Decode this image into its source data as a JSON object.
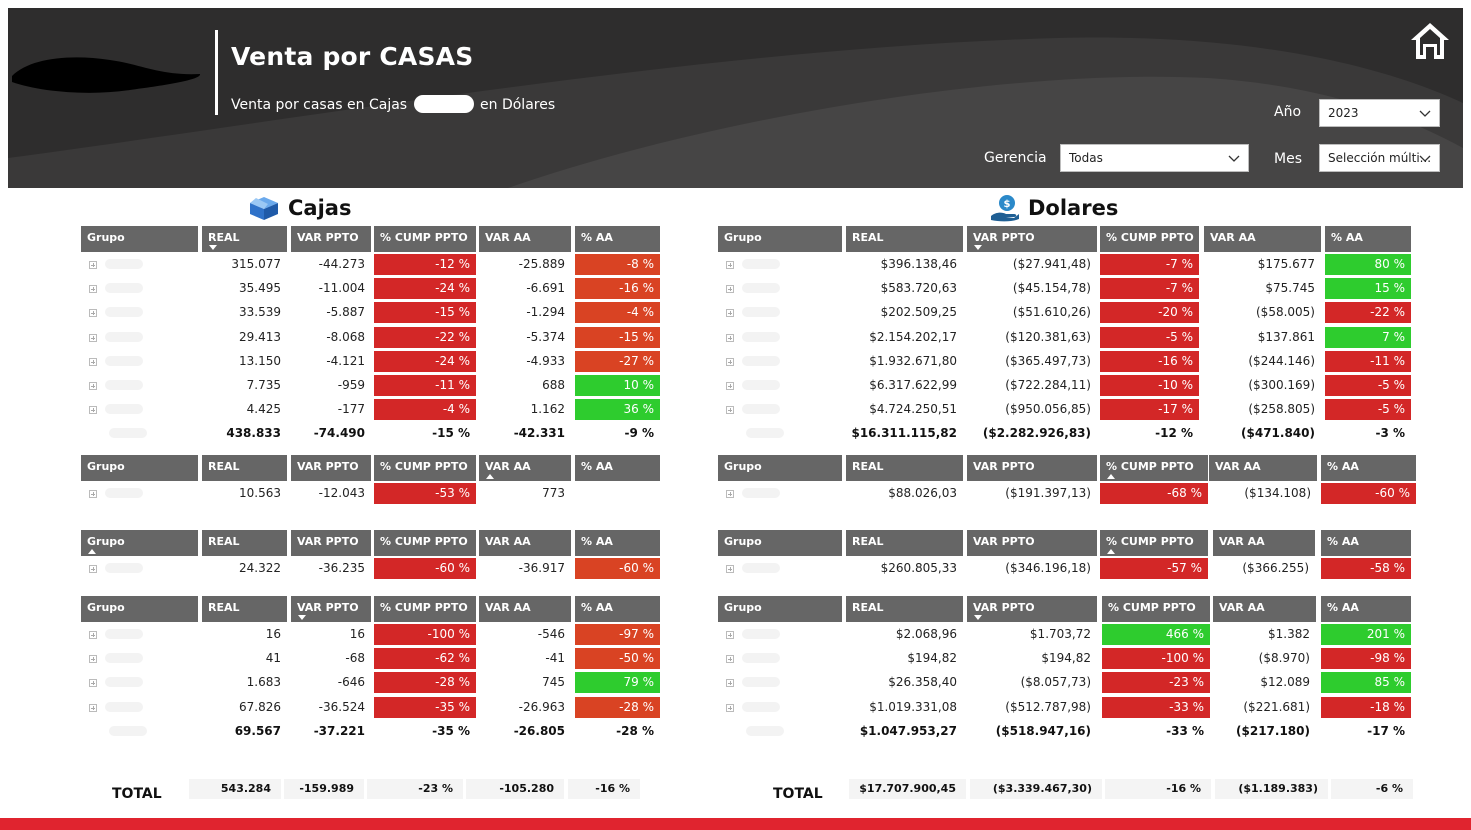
{
  "header": {
    "title": "Venta por CASAS",
    "subtitle_before": "Venta por casas en Cajas",
    "subtitle_after": "en Dólares",
    "filters": {
      "year_label": "Año",
      "year_value": "2023",
      "gerencia_label": "Gerencia",
      "gerencia_value": "Todas",
      "mes_label": "Mes",
      "mes_value": "Selección múlti..."
    },
    "home_icon": "home-icon"
  },
  "sections": {
    "left_title": "Cajas",
    "left_icon": "box-icon",
    "right_title": "Dolares",
    "right_icon": "money-hand-icon"
  },
  "colors": {
    "red": "#d32727",
    "orange_red": "#d94323",
    "green": "#2ecc2e",
    "header_gray": "#666666",
    "accent_bar": "#e0242f"
  },
  "left_tables": [
    {
      "columns": [
        "Grupo",
        "REAL",
        "VAR PPTO",
        "% CUMP PPTO",
        "VAR AA",
        "% AA"
      ],
      "sort_col": 1,
      "sort_dir": "down",
      "rows": [
        [
          "",
          "315.077",
          "-44.273",
          "-12 %",
          "-25.889",
          "-8 %"
        ],
        [
          "",
          "35.495",
          "-11.004",
          "-24 %",
          "-6.691",
          "-16 %"
        ],
        [
          "",
          "33.539",
          "-5.887",
          "-15 %",
          "-1.294",
          "-4 %"
        ],
        [
          "",
          "29.413",
          "-8.068",
          "-22 %",
          "-5.374",
          "-15 %"
        ],
        [
          "",
          "13.150",
          "-4.121",
          "-24 %",
          "-4.933",
          "-27 %"
        ],
        [
          "",
          "7.735",
          "-959",
          "-11 %",
          "688",
          "10 %"
        ],
        [
          "",
          "4.425",
          "-177",
          "-4 %",
          "1.162",
          "36 %"
        ]
      ],
      "colors": [
        [
          "red",
          "ored"
        ],
        [
          "red",
          "ored"
        ],
        [
          "red",
          "ored"
        ],
        [
          "red",
          "ored"
        ],
        [
          "red",
          "ored"
        ],
        [
          "red",
          "green"
        ],
        [
          "red",
          "green"
        ]
      ],
      "total": [
        "",
        "438.833",
        "-74.490",
        "-15 %",
        "-42.331",
        "-9 %"
      ]
    },
    {
      "columns": [
        "Grupo",
        "REAL",
        "VAR PPTO",
        "% CUMP PPTO",
        "VAR AA",
        "% AA"
      ],
      "sort_col": 4,
      "sort_dir": "up",
      "rows": [
        [
          "",
          "10.563",
          "-12.043",
          "-53 %",
          "773",
          ""
        ]
      ],
      "colors": [
        [
          "red",
          "none"
        ]
      ],
      "total": null
    },
    {
      "columns": [
        "Grupo",
        "REAL",
        "VAR PPTO",
        "% CUMP PPTO",
        "VAR AA",
        "% AA"
      ],
      "sort_col": 0,
      "sort_dir": "up",
      "rows": [
        [
          "",
          "24.322",
          "-36.235",
          "-60 %",
          "-36.917",
          "-60 %"
        ]
      ],
      "colors": [
        [
          "red",
          "ored"
        ]
      ],
      "total": null
    },
    {
      "columns": [
        "Grupo",
        "REAL",
        "VAR PPTO",
        "% CUMP PPTO",
        "VAR AA",
        "% AA"
      ],
      "sort_col": 2,
      "sort_dir": "down",
      "rows": [
        [
          "",
          "16",
          "16",
          "-100 %",
          "-546",
          "-97 %"
        ],
        [
          "",
          "41",
          "-68",
          "-62 %",
          "-41",
          "-50 %"
        ],
        [
          "",
          "1.683",
          "-646",
          "-28 %",
          "745",
          "79 %"
        ],
        [
          "",
          "67.826",
          "-36.524",
          "-35 %",
          "-26.963",
          "-28 %"
        ]
      ],
      "colors": [
        [
          "red",
          "ored"
        ],
        [
          "red",
          "ored"
        ],
        [
          "red",
          "green"
        ],
        [
          "red",
          "ored"
        ]
      ],
      "total": [
        "",
        "69.567",
        "-37.221",
        "-35 %",
        "-26.805",
        "-28 %"
      ]
    }
  ],
  "right_tables": [
    {
      "columns": [
        "Grupo",
        "REAL",
        "VAR PPTO",
        "% CUMP PPTO",
        "VAR AA",
        "% AA"
      ],
      "sort_col": 2,
      "sort_dir": "down",
      "rows": [
        [
          "",
          "$396.138,46",
          "($27.941,48)",
          "-7 %",
          "$175.677",
          "80 %"
        ],
        [
          "",
          "$583.720,63",
          "($45.154,78)",
          "-7 %",
          "$75.745",
          "15 %"
        ],
        [
          "",
          "$202.509,25",
          "($51.610,26)",
          "-20 %",
          "($58.005)",
          "-22 %"
        ],
        [
          "",
          "$2.154.202,17",
          "($120.381,63)",
          "-5 %",
          "$137.861",
          "7 %"
        ],
        [
          "",
          "$1.932.671,80",
          "($365.497,73)",
          "-16 %",
          "($244.146)",
          "-11 %"
        ],
        [
          "",
          "$6.317.622,99",
          "($722.284,11)",
          "-10 %",
          "($300.169)",
          "-5 %"
        ],
        [
          "",
          "$4.724.250,51",
          "($950.056,85)",
          "-17 %",
          "($258.805)",
          "-5 %"
        ]
      ],
      "colors": [
        [
          "red",
          "green"
        ],
        [
          "red",
          "green"
        ],
        [
          "red",
          "red"
        ],
        [
          "red",
          "green"
        ],
        [
          "red",
          "red"
        ],
        [
          "red",
          "red"
        ],
        [
          "red",
          "red"
        ]
      ],
      "total": [
        "",
        "$16.311.115,82",
        "($2.282.926,83)",
        "-12 %",
        "($471.840)",
        "-3 %"
      ]
    },
    {
      "columns": [
        "Grupo",
        "REAL",
        "VAR PPTO",
        "% CUMP PPTO",
        "VAR AA",
        "% AA"
      ],
      "sort_col": 3,
      "sort_dir": "up",
      "rows": [
        [
          "",
          "$88.026,03",
          "($191.397,13)",
          "-68 %",
          "($134.108)",
          "-60 %"
        ]
      ],
      "colors": [
        [
          "red",
          "red"
        ]
      ],
      "total": null
    },
    {
      "columns": [
        "Grupo",
        "REAL",
        "VAR PPTO",
        "% CUMP PPTO",
        "VAR AA",
        "% AA"
      ],
      "sort_col": 3,
      "sort_dir": "up",
      "rows": [
        [
          "",
          "$260.805,33",
          "($346.196,18)",
          "-57 %",
          "($366.255)",
          "-58 %"
        ]
      ],
      "colors": [
        [
          "red",
          "red"
        ]
      ],
      "total": null
    },
    {
      "columns": [
        "Grupo",
        "REAL",
        "VAR PPTO",
        "% CUMP PPTO",
        "VAR AA",
        "% AA"
      ],
      "sort_col": 2,
      "sort_dir": "down",
      "rows": [
        [
          "",
          "$2.068,96",
          "$1.703,72",
          "466 %",
          "$1.382",
          "201 %"
        ],
        [
          "",
          "$194,82",
          "$194,82",
          "-100 %",
          "($8.970)",
          "-98 %"
        ],
        [
          "",
          "$26.358,40",
          "($8.057,73)",
          "-23 %",
          "$12.089",
          "85 %"
        ],
        [
          "",
          "$1.019.331,08",
          "($512.787,98)",
          "-33 %",
          "($221.681)",
          "-18 %"
        ]
      ],
      "colors": [
        [
          "green",
          "green"
        ],
        [
          "red",
          "red"
        ],
        [
          "red",
          "green"
        ],
        [
          "red",
          "red"
        ]
      ],
      "total": [
        "",
        "$1.047.953,27",
        "($518.947,16)",
        "-33 %",
        "($217.180)",
        "-17 %"
      ]
    }
  ],
  "grand_total": {
    "left_label": "TOTAL",
    "left_values": [
      "543.284",
      "-159.989",
      "-23 %",
      "-105.280",
      "-16 %"
    ],
    "right_label": "TOTAL",
    "right_values": [
      "$17.707.900,45",
      "($3.339.467,30)",
      "-16 %",
      "($1.189.383)",
      "-6 %"
    ]
  }
}
